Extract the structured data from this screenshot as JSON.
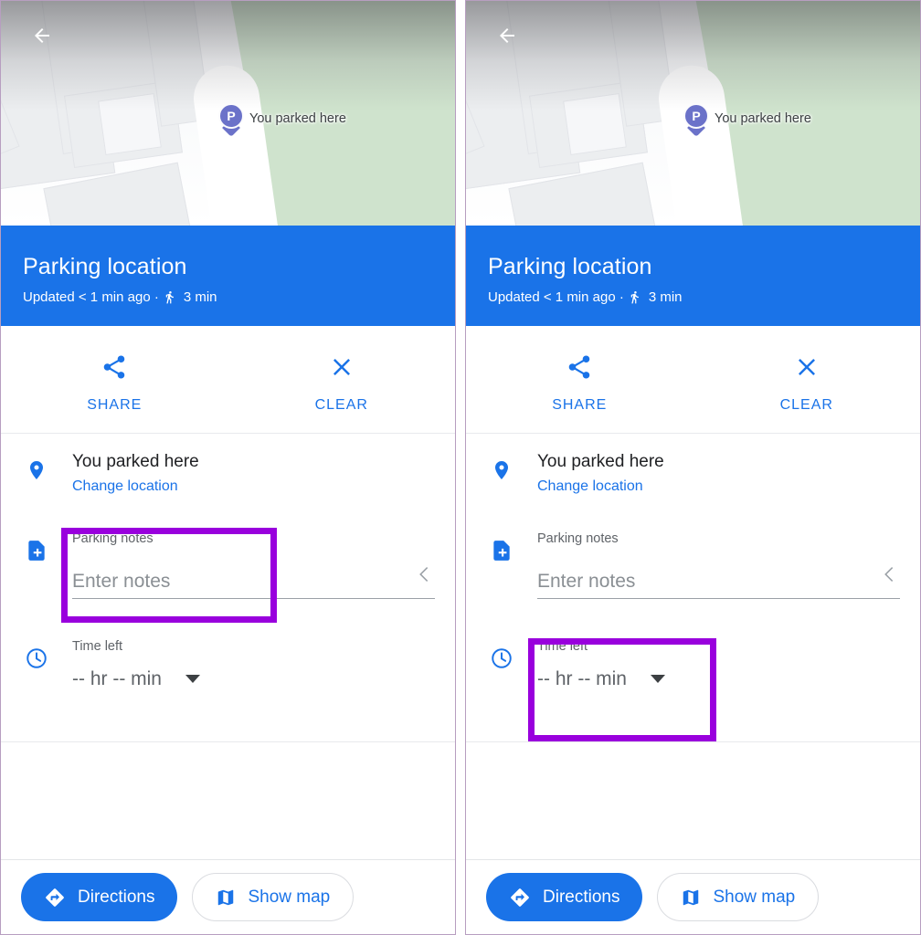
{
  "app": "Google Maps — Parking location",
  "map": {
    "back_icon": "back-arrow-icon",
    "pin_letter": "P",
    "pin_label": "You parked here"
  },
  "header": {
    "title": "Parking location",
    "updated": "Updated < 1 min ago ·",
    "walk_icon": "walking-person-icon",
    "walk_time": "3 min"
  },
  "actions": [
    {
      "icon": "share-icon",
      "label": "SHARE"
    },
    {
      "icon": "close-x-icon",
      "label": "CLEAR"
    }
  ],
  "rows": {
    "location": {
      "icon": "location-pin-icon",
      "title": "You parked here",
      "link": "Change location"
    },
    "notes": {
      "icon": "note-add-icon",
      "label": "Parking notes",
      "placeholder": "Enter notes",
      "chevron_icon": "chevron-left-icon"
    },
    "time": {
      "icon": "clock-icon",
      "label": "Time left",
      "value": "-- hr -- min",
      "caret_icon": "caret-down-icon"
    }
  },
  "bottom_bar": {
    "directions": {
      "icon": "directions-diamond-icon",
      "label": "Directions"
    },
    "show_map": {
      "icon": "map-folded-icon",
      "label": "Show map"
    }
  },
  "colors": {
    "accent_blue": "#1a73e8",
    "highlight_purple": "#9900dd",
    "map_green": "#cfe3cd",
    "pin_purple": "#6b72c9"
  },
  "annotations": {
    "left_highlight": "parking-notes-field",
    "right_highlight": "time-left-field"
  }
}
